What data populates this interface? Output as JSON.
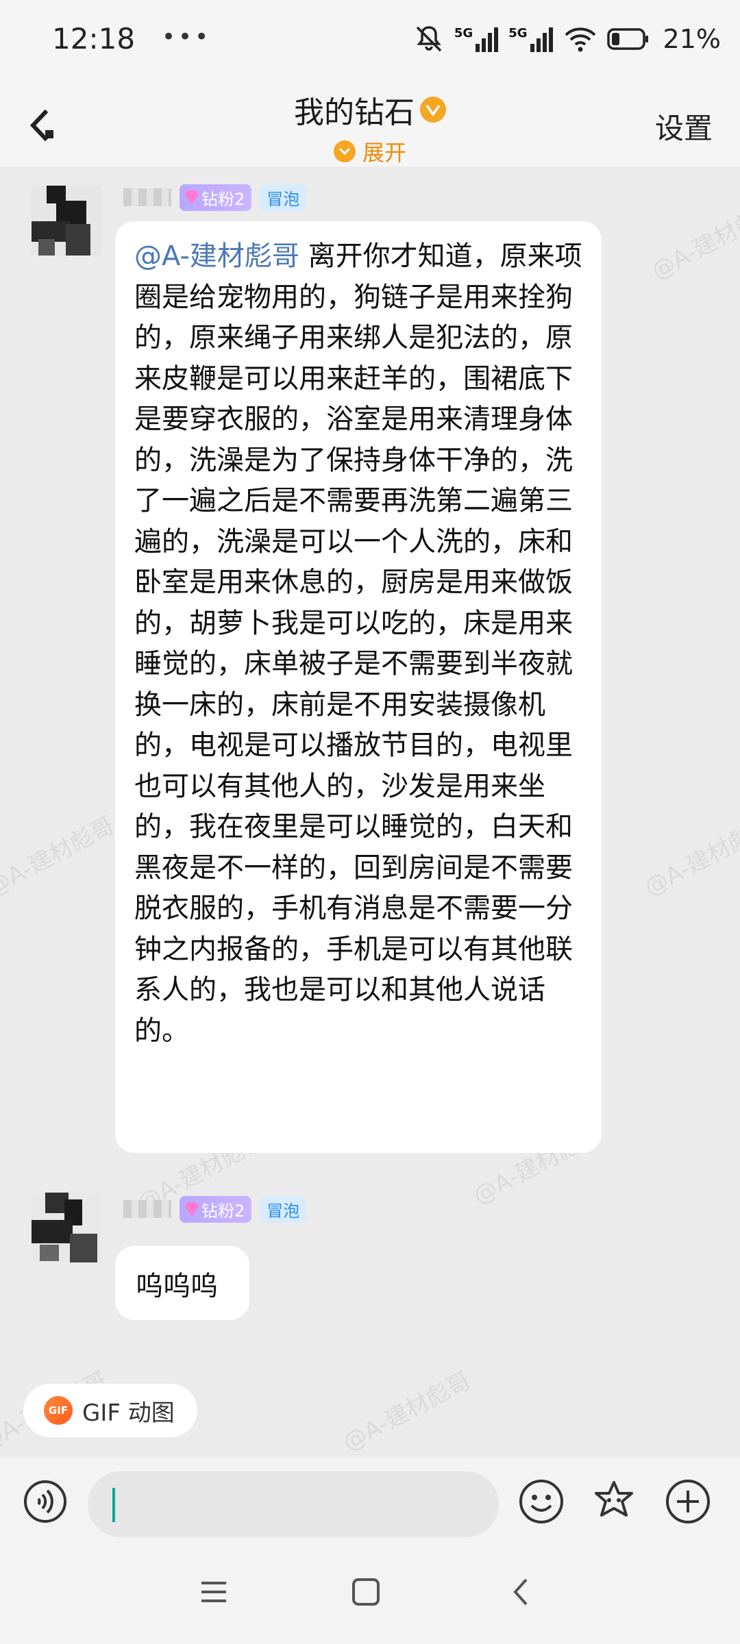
{
  "status_bar": {
    "time": "12:18",
    "dots": "•••",
    "network_1": "5G",
    "network_2": "5G",
    "battery_pct": "21%",
    "battery_level": 0.21
  },
  "header": {
    "title": "我的钻石",
    "expand_label": "展开",
    "settings_label": "设置"
  },
  "messages": [
    {
      "badge_fan": "钻粉2",
      "badge_pao": "冒泡",
      "mention": "@A-建材彪哥",
      "text": " 离开你才知道，原来项圈是给宠物用的，狗链子是用来拴狗的，原来绳子用来绑人是犯法的，原来皮鞭是可以用来赶羊的，围裙底下是要穿衣服的，浴室是用来清理身体的，洗澡是为了保持身体干净的，洗了一遍之后是不需要再洗第二遍第三遍的，洗澡是可以一个人洗的，床和卧室是用来休息的，厨房是用来做饭的，胡萝卜我是可以吃的，床是用来睡觉的，床单被子是不需要到半夜就换一床的，床前是不用安装摄像机的，电视是可以播放节目的，电视里也可以有其他人的，沙发是用来坐的，我在夜里是可以睡觉的，白天和黑夜是不一样的，回到房间是不需要脱衣服的，手机有消息是不需要一分钟之内报备的，手机是可以有其他联系人的，我也是可以和其他人说话的。"
    },
    {
      "badge_fan": "钻粉2",
      "badge_pao": "冒泡",
      "text": "呜呜呜"
    }
  ],
  "watermark": "@A-建材彪哥",
  "gif_chip": {
    "icon_text": "GIF",
    "label": "GIF 动图"
  },
  "colors": {
    "accent_orange": "#f5a623",
    "mention_blue": "#4a78b8",
    "caret_teal": "#0aa59c"
  }
}
